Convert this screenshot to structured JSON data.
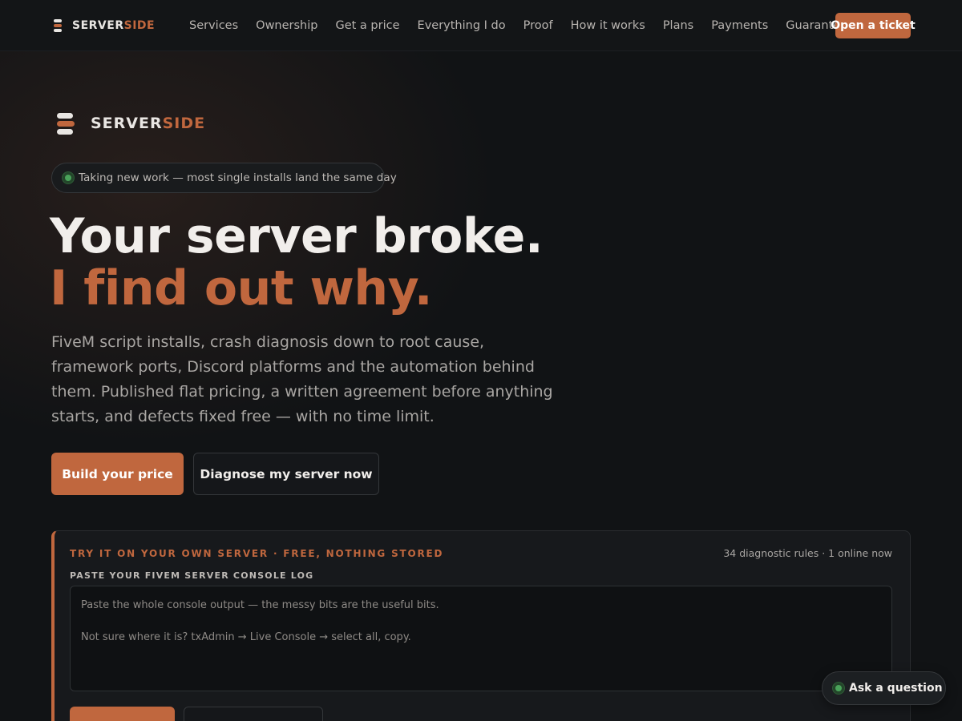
{
  "brand": {
    "name_part1": "SERVER",
    "name_part2": "SIDE",
    "accent_color": "#c0673e",
    "logo_icon": "stacked-bars-logo-icon"
  },
  "nav": {
    "links": [
      "Services",
      "Ownership",
      "Get a price",
      "Everything I do",
      "Proof",
      "How it works",
      "Plans",
      "Payments",
      "Guarantee"
    ],
    "cta_label": "Open a ticket"
  },
  "hero": {
    "status_pill": "Taking new work — most single installs land the same day",
    "status_color": "#4aa35a",
    "headline_line1": "Your server broke.",
    "headline_line2": "I find out why.",
    "lede": "FiveM script installs, crash diagnosis down to root cause, framework ports, Discord platforms and the automation behind them. Published flat pricing, a written agreement before anything starts, and defects fixed free — with no time limit.",
    "primary_button": "Build your price",
    "secondary_button": "Diagnose my server now"
  },
  "diagnose_panel": {
    "eyebrow": "TRY IT ON YOUR OWN SERVER · FREE, NOTHING STORED",
    "meta": "34 diagnostic rules · 1 online now",
    "field_label": "PASTE YOUR FIVEM SERVER CONSOLE LOG",
    "placeholder": "Paste the whole console output — the messy bits are the useful bits.\n\nNot sure where it is? txAdmin → Live Console → select all, copy.",
    "value": ""
  },
  "chat_widget": {
    "label": "Ask a question",
    "status_color": "#4aa35a"
  }
}
